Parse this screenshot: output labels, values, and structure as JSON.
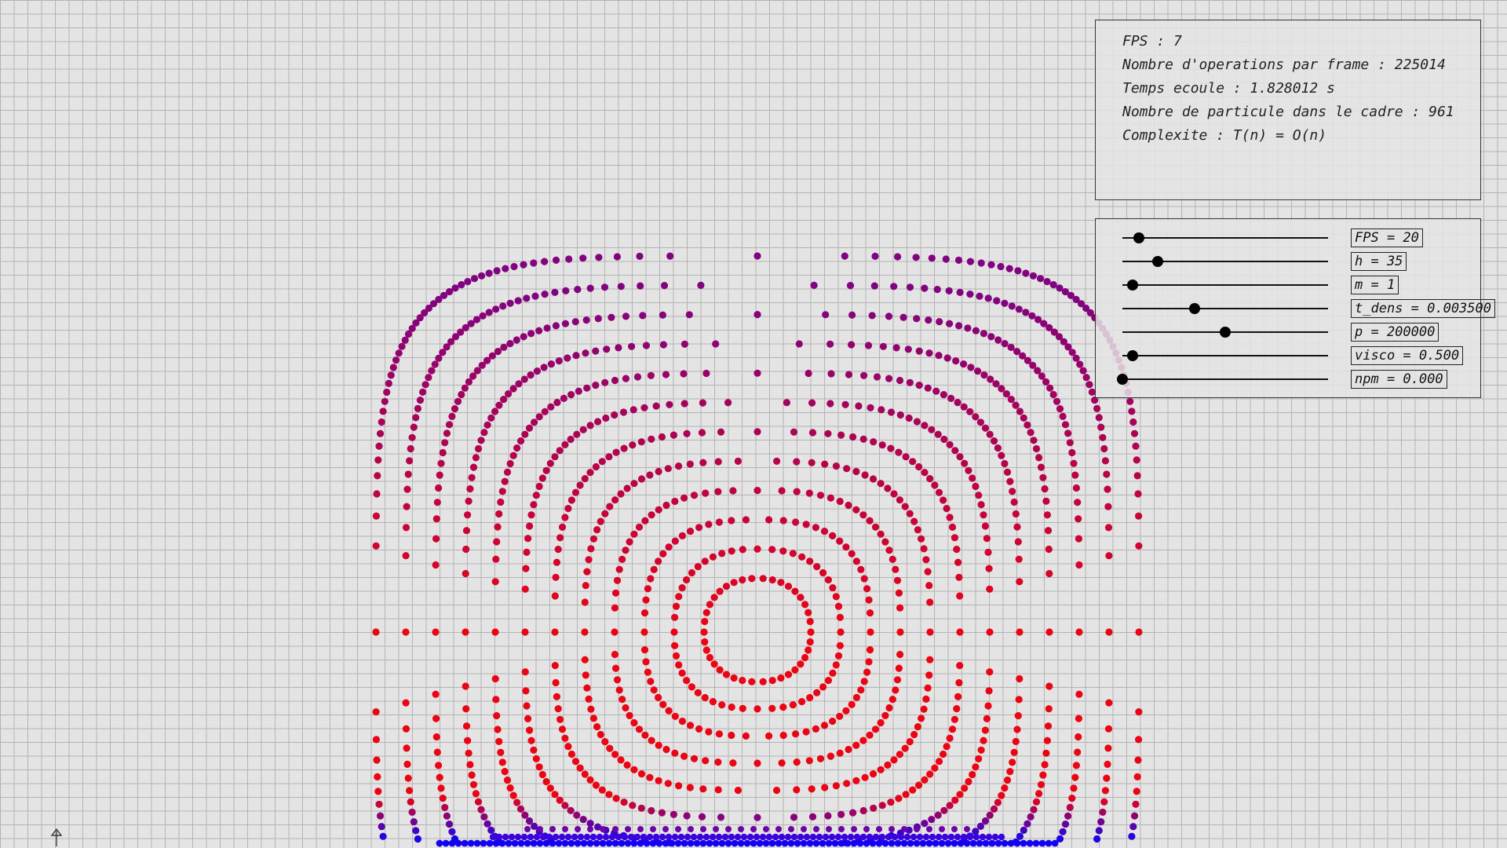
{
  "info": {
    "fps": "FPS : 7",
    "operations": "Nombre d'operations par frame : 225014",
    "elapsed": "Temps ecoule : 1.828012 s",
    "particles": "Nombre de particule dans le cadre : 961",
    "complexity": "Complexite : T(n) = O(n)"
  },
  "sliders": [
    {
      "id": "fps",
      "label": "FPS = 20",
      "fraction": 0.08
    },
    {
      "id": "h",
      "label": "h = 35",
      "fraction": 0.17
    },
    {
      "id": "m",
      "label": "m = 1",
      "fraction": 0.05
    },
    {
      "id": "t_dens",
      "label": "t_dens = 0.003500",
      "fraction": 0.35
    },
    {
      "id": "p",
      "label": "p = 200000",
      "fraction": 0.5
    },
    {
      "id": "visco",
      "label": "visco = 0.500",
      "fraction": 0.05
    },
    {
      "id": "npm",
      "label": "npm = 0.000",
      "fraction": 0.0
    }
  ],
  "colors": {
    "background": "#e4e4e4",
    "grid": "#b4b4b4",
    "particle_high": "#ff0000",
    "particle_mid": "#800080",
    "particle_low": "#0000ff"
  },
  "icons": {
    "origin": "arrow-up-icon"
  }
}
